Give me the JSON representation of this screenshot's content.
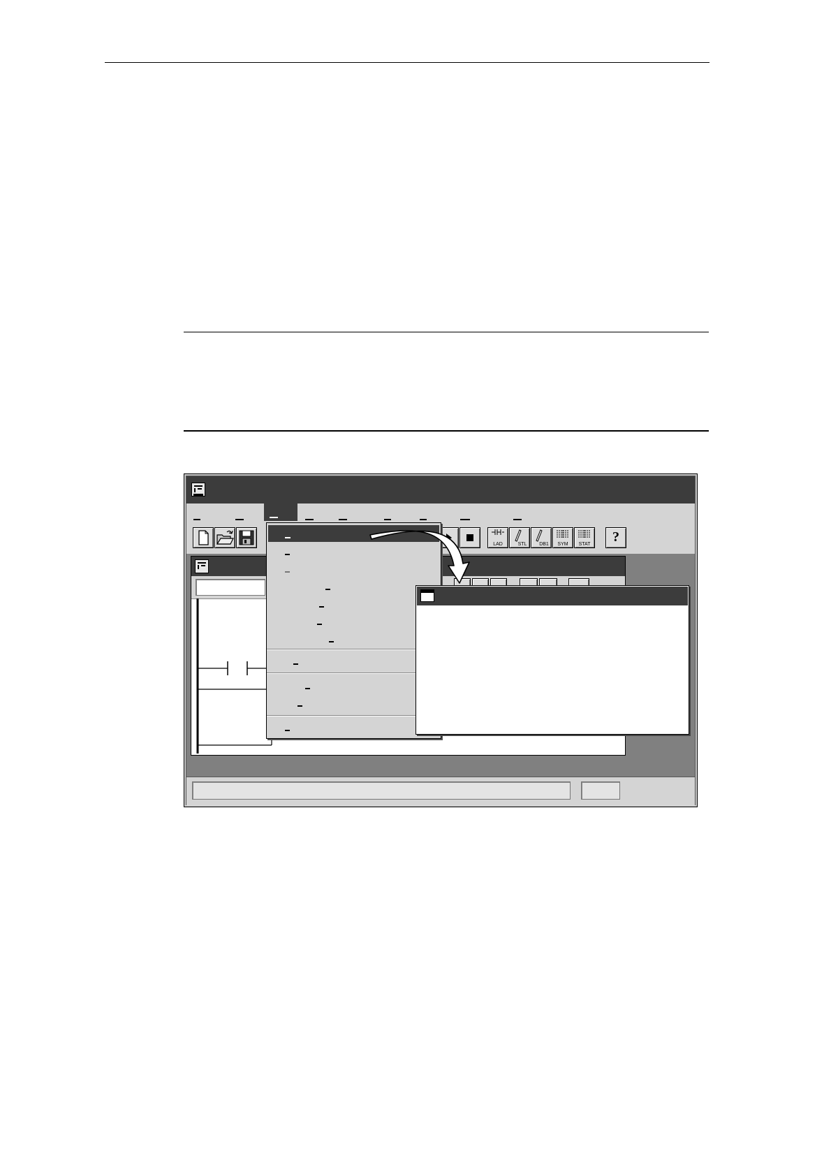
{
  "page": {
    "top_rule": "present",
    "section_rules": "two horizontal rules",
    "figure_text_visible": "none"
  },
  "app_window": {
    "title": "",
    "menu_items": [
      "",
      "",
      "",
      "",
      "",
      "",
      "",
      "",
      ""
    ],
    "selected_menu_index": 2,
    "toolbar": {
      "new_label": "",
      "run_label": "",
      "stop_label": "",
      "editor_buttons": [
        "LAD",
        "STL",
        "DB1",
        "SYM",
        "STAT"
      ],
      "help_glyph": "?"
    },
    "status_text": "",
    "status_field": ""
  },
  "dropdown_menu": {
    "items": [
      "",
      "",
      "",
      "",
      "",
      "",
      "",
      "",
      "",
      "",
      ""
    ],
    "highlighted_index": 0
  },
  "dialog_window": {
    "title": ""
  },
  "colors": {
    "title_bar": "#3c3c3c",
    "workspace": "#808080",
    "face": "#d4d4d4"
  },
  "icons": [
    "app-icon",
    "new-file-icon",
    "open-folder-icon",
    "save-disk-icon",
    "run-icon",
    "stop-icon",
    "help-icon",
    "curved-arrow-icon",
    "contact-icon"
  ]
}
